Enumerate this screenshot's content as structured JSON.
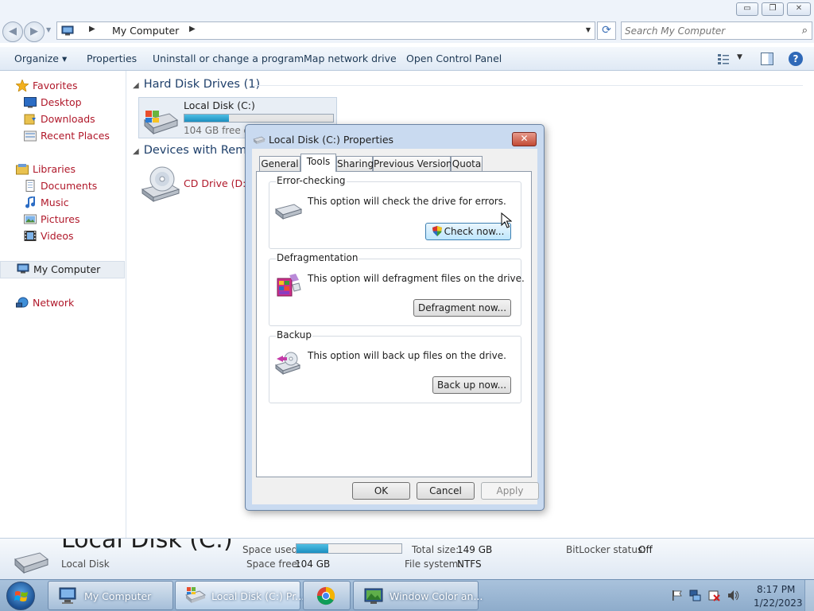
{
  "window": {
    "minimize_label": "▭",
    "maximize_label": "❐",
    "close_label": "✕"
  },
  "address": {
    "path": "My Computer",
    "search_placeholder": "Search My Computer"
  },
  "commands": {
    "organize": "Organize ▾",
    "properties": "Properties",
    "uninstall": "Uninstall or change a program",
    "map_drive": "Map network drive",
    "control_panel": "Open Control Panel"
  },
  "sidebar": {
    "favorites": "Favorites",
    "desktop": "Desktop",
    "downloads": "Downloads",
    "recent": "Recent Places",
    "libraries": "Libraries",
    "documents": "Documents",
    "music": "Music",
    "pictures": "Pictures",
    "videos": "Videos",
    "my_computer": "My Computer",
    "network": "Network"
  },
  "content": {
    "hdd_group": "Hard Disk Drives (1)",
    "removable_group": "Devices with Removable Storage (1)",
    "drive_c": {
      "label": "Local Disk (C:)",
      "free": "104 GB free of 149 GB",
      "used_fraction": 0.3
    },
    "drive_d": {
      "label": "CD Drive (D:)"
    }
  },
  "details": {
    "title": "Local Disk (C:)",
    "subtitle": "Local Disk",
    "space_used_label": "Space used:",
    "space_free_label": "Space free:",
    "space_free_value": "104 GB",
    "total_size_label": "Total size:",
    "total_size_value": "149 GB",
    "filesystem_label": "File system:",
    "filesystem_value": "NTFS",
    "bitlocker_label": "BitLocker status:",
    "bitlocker_value": "Off",
    "used_fraction": 0.3
  },
  "dialog": {
    "title": "Local Disk (C:) Properties",
    "close_label": "✕",
    "tabs": {
      "general": "General",
      "tools": "Tools",
      "sharing": "Sharing",
      "previous_versions": "Previous Versions",
      "quota": "Quota"
    },
    "error_checking": {
      "title": "Error-checking",
      "text": "This option will check the drive for errors.",
      "button": "Check now..."
    },
    "defragmentation": {
      "title": "Defragmentation",
      "text": "This option will defragment files on the drive.",
      "button": "Defragment now..."
    },
    "backup": {
      "title": "Backup",
      "text": "This option will back up files on the drive.",
      "button": "Back up now..."
    },
    "ok": "OK",
    "cancel": "Cancel",
    "apply": "Apply"
  },
  "taskbar": {
    "my_computer": "My Computer",
    "local_disk": "Local Disk (C:) Pr...",
    "window_color": "Window Color an...",
    "time": "8:17 PM",
    "date": "1/22/2023"
  },
  "colors": {
    "link_red": "#b0182a",
    "group_blue": "#1e3f6a",
    "progress": "#1c8fc0"
  }
}
